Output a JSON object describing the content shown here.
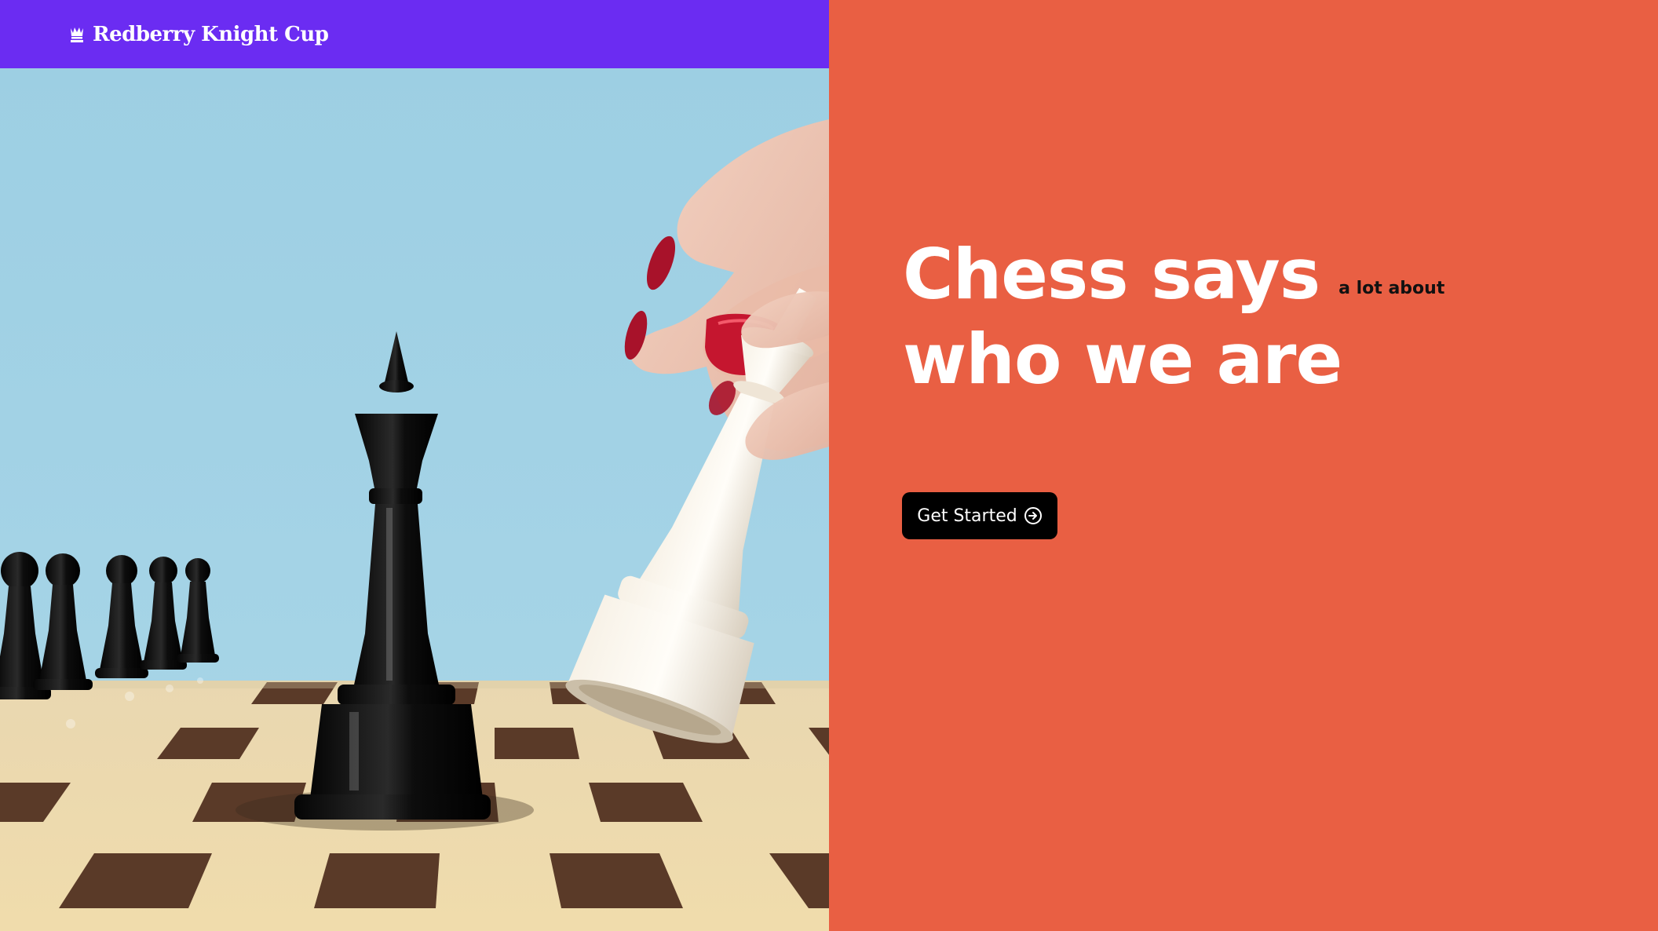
{
  "header": {
    "brand_name": "Redberry Knight Cup",
    "brand_icon": "chess-queen-icon",
    "background": "#6b2cf2"
  },
  "hero": {
    "headline_line1": "Chess says",
    "headline_aside": "a lot about",
    "headline_line2": "who we are",
    "background": "#e95f43",
    "cta_label": "Get Started",
    "cta_icon": "arrow-right-circle-icon"
  },
  "image": {
    "subject": "chess-scene"
  }
}
